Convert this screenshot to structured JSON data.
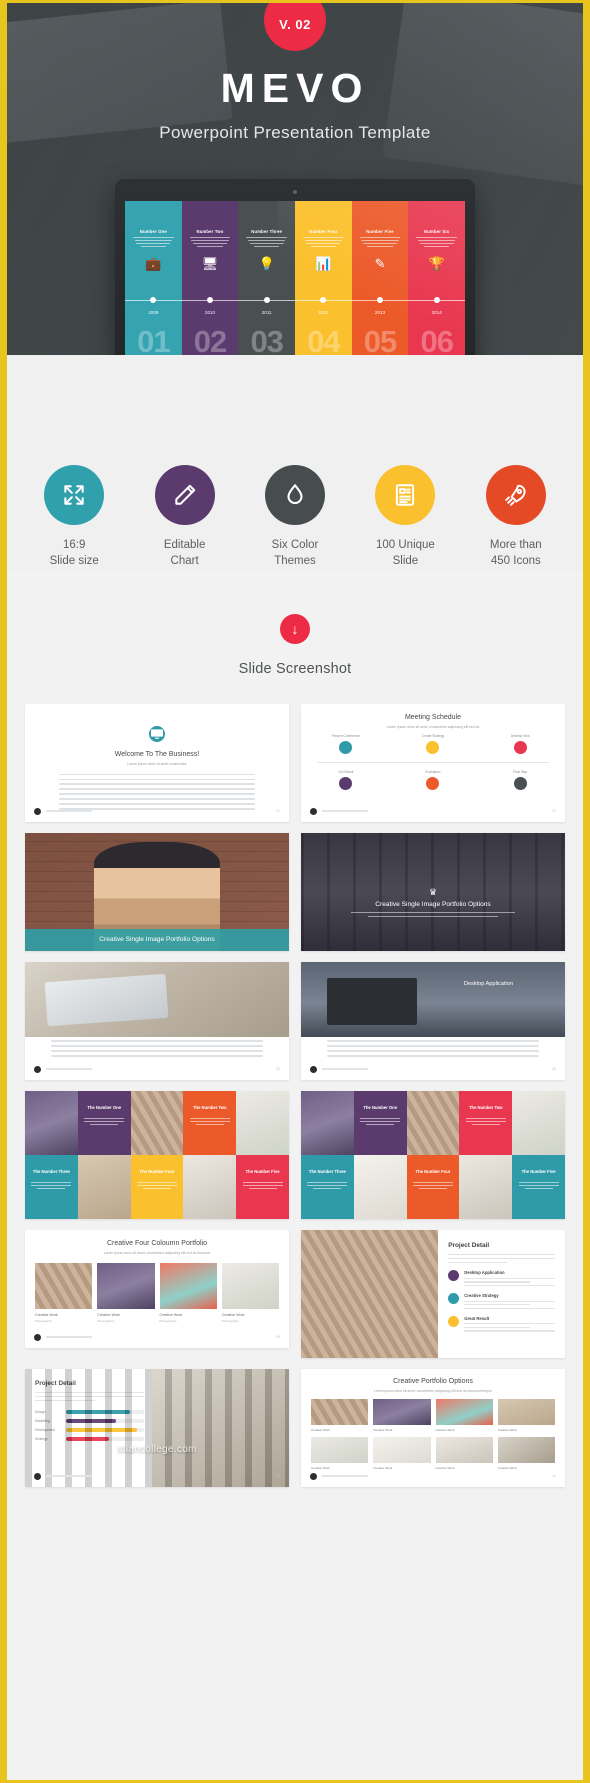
{
  "brand": {
    "version_badge": "V. 02",
    "title": "MEVO",
    "subtitle": "Powerpoint Presentation Template",
    "accent_red": "#ed2b45",
    "accent_yellow": "#e8c51c",
    "hero_bg": "#4c5254"
  },
  "hero_screen": {
    "columns": [
      {
        "title": "Number One",
        "year": "2009",
        "number": "01",
        "color": "#35a3b0",
        "icon": "briefcase-icon",
        "glyph": "💼"
      },
      {
        "title": "Number Two",
        "year": "2010",
        "number": "02",
        "color": "#5b3a6e",
        "icon": "monitor-icon",
        "glyph": "🖥"
      },
      {
        "title": "Number Three",
        "year": "2011",
        "number": "03",
        "color": "#4a5052",
        "icon": "bulb-icon",
        "glyph": "💡"
      },
      {
        "title": "Number Four",
        "year": "2012",
        "number": "04",
        "color": "#fbc02d",
        "icon": "bar-chart-icon",
        "glyph": "📊"
      },
      {
        "title": "Number Five",
        "year": "2013",
        "number": "05",
        "color": "#ec5a2a",
        "icon": "pencil-icon",
        "glyph": "✎"
      },
      {
        "title": "Number Six",
        "year": "2014",
        "number": "06",
        "color": "#e8374f",
        "icon": "trophy-icon",
        "glyph": "🏆"
      }
    ]
  },
  "features": [
    {
      "icon": "expand-arrows-icon",
      "color": "#30a0ad",
      "label": "16:9\nSlide size"
    },
    {
      "icon": "pencil-icon",
      "color": "#5b3a6e",
      "label": "Editable\nChart"
    },
    {
      "icon": "water-drop-icon",
      "color": "#474d4f",
      "label": "Six Color\nThemes"
    },
    {
      "icon": "document-icon",
      "color": "#fbc02d",
      "label": "100 Unique\nSlide"
    },
    {
      "icon": "rocket-icon",
      "color": "#e54a27",
      "label": "More than\n450 Icons"
    }
  ],
  "screenshots_section": {
    "arrow_icon": "arrow-down-icon",
    "heading": "Slide Screenshot"
  },
  "slides": [
    {
      "id": "welcome-business",
      "type": "text-intro",
      "title": "Welcome To The Business!",
      "subtitle": "Lorem ipsum dolor sit amet consectetur",
      "circle_color": "#2f9aa8",
      "circle_icon": "monitor-icon",
      "page": "01"
    },
    {
      "id": "meeting-schedule",
      "type": "timeline",
      "title": "Meeting Schedule",
      "subtitle": "Lorem ipsum dolor sit amet, consectetur adipiscing elit sed do",
      "page": "02",
      "nodes": [
        {
          "label": "Present\nConference",
          "color": "#2f9aa8"
        },
        {
          "label": "Create\nStrategy",
          "color": "#fbc02d"
        },
        {
          "label": "Develop\nIdea",
          "color": "#e8374f"
        },
        {
          "label": "Get Result",
          "color": "#5b3a6e"
        },
        {
          "label": "Evaluation",
          "color": "#ec5a2a"
        },
        {
          "label": "Final Step",
          "color": "#4a5052"
        }
      ]
    },
    {
      "id": "portfolio-brick",
      "type": "photo-band",
      "caption": "Creative Single Image Portfolio Options",
      "photo": "ph-brick",
      "band_color": "#2ca0a8"
    },
    {
      "id": "portfolio-forest",
      "type": "photo-center",
      "caption": "Creative Single Image Portfolio Options",
      "subtitle": "Nam nec tempor aenean ut justo, elit luctus amet lorem. Cras de quam a mollis ipsum sed lorem ipsum dolor.",
      "photo": "ph-forest",
      "icon": "trophy-icon"
    },
    {
      "id": "desk-photo",
      "type": "photo-top-text",
      "photo": "ph-desk",
      "page": "05"
    },
    {
      "id": "desktop-application",
      "type": "photo-device",
      "caption": "Desktop Application",
      "photo": "ph-road",
      "page": "06"
    },
    {
      "id": "mosaic-portfolio-a",
      "type": "mosaic",
      "page": "07",
      "tiles": [
        {
          "kind": "photo",
          "photo": "ph-woman-tile",
          "color": "#8d7fa0"
        },
        {
          "kind": "text",
          "title": "The Number One",
          "color": "#5b3a6e"
        },
        {
          "kind": "photo",
          "photo": "ph-corks",
          "color": "#c0a58d"
        },
        {
          "kind": "text",
          "title": "The Number Two",
          "color": "#ec5a2a"
        },
        {
          "kind": "photo",
          "photo": "ph-plant",
          "color": "#e2e0da"
        },
        {
          "kind": "text",
          "title": "The Number Three",
          "color": "#2f9aa8"
        },
        {
          "kind": "photo",
          "photo": "ph-box",
          "color": "#cbb9a4"
        },
        {
          "kind": "text",
          "title": "The Number Four",
          "color": "#fbc02d"
        },
        {
          "kind": "photo",
          "photo": "ph-shoe",
          "color": "#ded9d2"
        },
        {
          "kind": "text",
          "title": "The Number Five",
          "color": "#e8374f"
        }
      ]
    },
    {
      "id": "mosaic-portfolio-b",
      "type": "mosaic",
      "page": "08",
      "tiles": [
        {
          "kind": "photo",
          "photo": "ph-woman-tile",
          "color": "#8d7fa0"
        },
        {
          "kind": "text",
          "title": "The Number One",
          "color": "#5b3a6e"
        },
        {
          "kind": "photo",
          "photo": "ph-corks",
          "color": "#c0a58d"
        },
        {
          "kind": "text",
          "title": "The Number Two",
          "color": "#e8374f"
        },
        {
          "kind": "photo",
          "photo": "ph-plant",
          "color": "#e2e0da"
        },
        {
          "kind": "text",
          "title": "The Number Three",
          "color": "#2f9aa8"
        },
        {
          "kind": "photo",
          "photo": "ph-badge",
          "color": "#f0eee9"
        },
        {
          "kind": "text",
          "title": "The Number Four",
          "color": "#ec5a2a"
        },
        {
          "kind": "photo",
          "photo": "ph-shoe",
          "color": "#ded9d2"
        },
        {
          "kind": "text",
          "title": "The Number Five",
          "color": "#2f9aa8"
        }
      ]
    },
    {
      "id": "four-column-portfolio",
      "type": "quad",
      "title": "Creative Four Coloumn Portfolio",
      "subtitle": "Lorem ipsum dolor sit amet, consectetur adipiscing elit sed do eiusmod",
      "page": "09",
      "items": [
        {
          "caption": "Creative Work",
          "sub": "Photography",
          "photo": "ph-corks"
        },
        {
          "caption": "Creative Work",
          "sub": "Photography",
          "photo": "ph-woman-tile"
        },
        {
          "caption": "Creative Work",
          "sub": "Photography",
          "photo": "ph-tulip"
        },
        {
          "caption": "Creative Work",
          "sub": "Photography",
          "photo": "ph-plant"
        }
      ]
    },
    {
      "id": "project-detail-right",
      "type": "project-detail",
      "title": "Project Detail",
      "subtitle": "Suffice consectetur amet, consectetur elit dolor sed lorem. Tempor incididunt ut labore dolore magna aliqua.",
      "photo": "ph-corks",
      "page": "10",
      "items": [
        {
          "title": "Desktop Application",
          "color": "#5b3a6e"
        },
        {
          "title": "Creative Strategy",
          "color": "#2f9aa8"
        },
        {
          "title": "Great Result",
          "color": "#fbc02d"
        }
      ]
    },
    {
      "id": "project-detail-left",
      "type": "project-detail-bars",
      "title": "Project Detail",
      "subtitle": "Suffice consectetur amet, consectetur elit dolor sed lorem. Tempor incididunt ut labore.",
      "photo": "ph-city",
      "watermark": "stlancollege.com",
      "page": "11",
      "bars": [
        {
          "label": "Design",
          "value": 82,
          "color": "#2f9aa8"
        },
        {
          "label": "Marketing",
          "value": 64,
          "color": "#5b3a6e"
        },
        {
          "label": "Development",
          "value": 91,
          "color": "#fbc02d"
        },
        {
          "label": "Strategy",
          "value": 55,
          "color": "#e8374f"
        }
      ]
    },
    {
      "id": "creative-portfolio-options",
      "type": "portfolio-grid",
      "title": "Creative Portfolio Options",
      "subtitle": "Lorem ipsum dolor sit amet, consectetur adipiscing elit sed do eiusmod tempor",
      "page": "12",
      "cells": [
        {
          "caption": "Creative Work",
          "sub": "Photography",
          "photo": "ph-corks"
        },
        {
          "caption": "Creative Work",
          "sub": "Photography",
          "photo": "ph-woman-tile"
        },
        {
          "caption": "Creative Work",
          "sub": "Photography",
          "photo": "ph-tulip"
        },
        {
          "caption": "Creative Work",
          "sub": "Photography",
          "photo": "ph-box"
        },
        {
          "caption": "Creative Work",
          "sub": "Photography",
          "photo": "ph-plant"
        },
        {
          "caption": "Creative Work",
          "sub": "Photography",
          "photo": "ph-badge"
        },
        {
          "caption": "Creative Work",
          "sub": "Photography",
          "photo": "ph-shoe"
        },
        {
          "caption": "Creative Work",
          "sub": "Photography",
          "photo": "ph-desk"
        }
      ]
    }
  ]
}
